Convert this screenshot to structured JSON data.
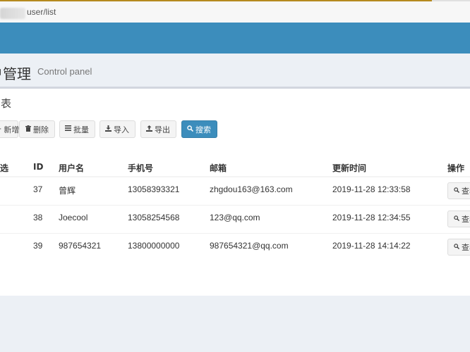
{
  "browser": {
    "url": "user/list"
  },
  "header": {
    "title": "户管理",
    "subtitle": "Control panel"
  },
  "box": {
    "title": "列表"
  },
  "toolbar": {
    "buttons": [
      {
        "label": "新增",
        "icon": "plus-icon"
      },
      {
        "label": "删除",
        "icon": "trash-icon"
      },
      {
        "label": "批量",
        "icon": "bars-icon"
      },
      {
        "label": "导入",
        "icon": "download-icon"
      },
      {
        "label": "导出",
        "icon": "upload-icon"
      },
      {
        "label": "搜索",
        "icon": "search-icon"
      }
    ]
  },
  "table": {
    "headers": [
      "全选",
      "ID",
      "用户名",
      "手机号",
      "邮箱",
      "更新时间",
      "操作"
    ],
    "rows": [
      {
        "id": "37",
        "username": "曾辉",
        "phone": "13058393321",
        "email": "zhgdou163@163.com",
        "updated": "2019-11-28 12:33:58",
        "action": "查看"
      },
      {
        "id": "38",
        "username": "Joecool",
        "phone": "13058254568",
        "email": "123@qq.com",
        "updated": "2019-11-28 12:34:55",
        "action": "查看"
      },
      {
        "id": "39",
        "username": "987654321",
        "phone": "13800000000",
        "email": "987654321@qq.com",
        "updated": "2019-11-28 14:14:22",
        "action": "查看"
      }
    ]
  },
  "colors": {
    "navbar": "#3c8dbc",
    "background": "#ecf0f5",
    "primary_button": "#3c8dbc"
  }
}
